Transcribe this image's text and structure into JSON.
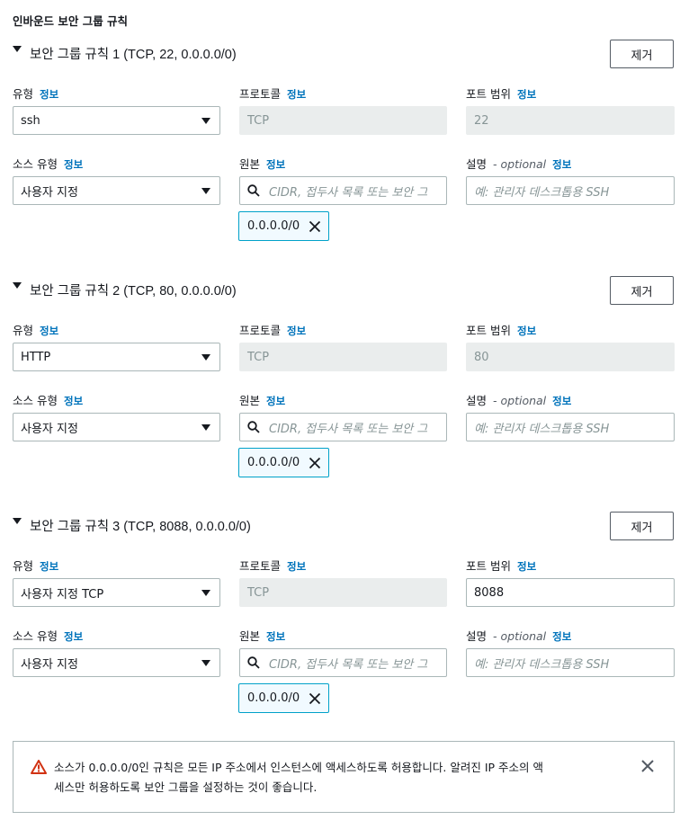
{
  "section": {
    "title": "인바운드 보안 그룹 규칙"
  },
  "labels": {
    "type": "유형",
    "protocol": "프로토콜",
    "port_range": "포트 범위",
    "source_type": "소스 유형",
    "source": "원본",
    "description": "설명",
    "optional": "- optional",
    "info": "정보"
  },
  "remove_label": "제거",
  "source_placeholder": "CIDR, 접두사 목록 또는 보안 그",
  "description_placeholder": "예: 관리자 데스크톱용 SSH",
  "rules": [
    {
      "title": "보안 그룹 규칙 1 (TCP, 22, 0.0.0.0/0)",
      "type": "ssh",
      "protocol": "TCP",
      "port": "22",
      "port_editable": false,
      "source_type": "사용자 지정",
      "cidr": "0.0.0.0/0"
    },
    {
      "title": "보안 그룹 규칙 2 (TCP, 80, 0.0.0.0/0)",
      "type": "HTTP",
      "protocol": "TCP",
      "port": "80",
      "port_editable": false,
      "source_type": "사용자 지정",
      "cidr": "0.0.0.0/0"
    },
    {
      "title": "보안 그룹 규칙 3 (TCP, 8088, 0.0.0.0/0)",
      "type": "사용자 지정 TCP",
      "protocol": "TCP",
      "port": "8088",
      "port_editable": true,
      "source_type": "사용자 지정",
      "cidr": "0.0.0.0/0"
    }
  ],
  "alert": {
    "line1": "소스가 0.0.0.0/0인 규칙은 모든 IP 주소에서 인스턴스에 액세스하도록 허용합니다. 알려진 IP 주소의 액",
    "line2": "세스만 허용하도록 보안 그룹을 설정하는 것이 좋습니다.",
    "icon": "warning-icon",
    "color": "#d13212"
  }
}
